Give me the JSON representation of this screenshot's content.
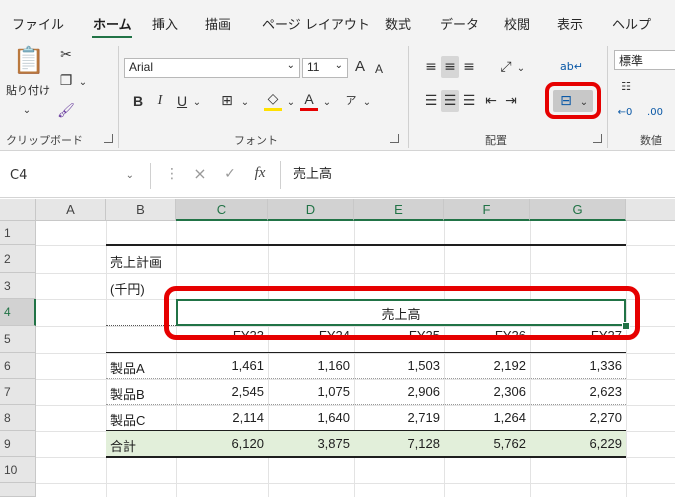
{
  "ribbon_tabs": [
    "ファイル",
    "ホーム",
    "挿入",
    "描画",
    "ページ レイアウト",
    "数式",
    "データ",
    "校閲",
    "表示",
    "ヘルプ"
  ],
  "active_tab": "ホーム",
  "groups": {
    "clipboard": {
      "label": "クリップボード",
      "paste_label": "貼り付け"
    },
    "font": {
      "label": "フォント",
      "font_name": "Arial",
      "font_size": "11",
      "bold": "B",
      "italic": "I",
      "underline": "U",
      "grow": "A",
      "shrink": "A",
      "font_color_glyph": "A"
    },
    "alignment": {
      "label": "配置"
    },
    "number": {
      "label": "数値",
      "format": "標準"
    }
  },
  "formula_bar": {
    "name_box": "C4",
    "fx": "fx",
    "content": "売上高",
    "cancel": "×",
    "enter": "✓"
  },
  "columns": [
    "A",
    "B",
    "C",
    "D",
    "E",
    "F",
    "G"
  ],
  "rows": [
    "1",
    "2",
    "3",
    "4",
    "5",
    "6",
    "7",
    "8",
    "9",
    "10"
  ],
  "selected_cell": {
    "column": "C",
    "row": "4"
  },
  "sheet": {
    "title": "売上計画",
    "unit": "(千円)",
    "header_merged": "売上高",
    "year_labels": [
      "FY23",
      "FY24",
      "FY25",
      "FY26",
      "FY27"
    ],
    "products": [
      {
        "name": "製品A",
        "values": [
          "1,461",
          "1,160",
          "1,503",
          "2,192",
          "1,336"
        ]
      },
      {
        "name": "製品B",
        "values": [
          "2,545",
          "1,075",
          "2,906",
          "2,306",
          "2,623"
        ]
      },
      {
        "name": "製品C",
        "values": [
          "2,114",
          "1,640",
          "2,719",
          "1,264",
          "2,270"
        ]
      }
    ],
    "total": {
      "name": "合計",
      "values": [
        "6,120",
        "3,875",
        "7,128",
        "5,762",
        "6,229"
      ]
    }
  },
  "colors": {
    "excel_green": "#217346",
    "highlight_red": "#e60000",
    "total_row": "#e2efda"
  }
}
